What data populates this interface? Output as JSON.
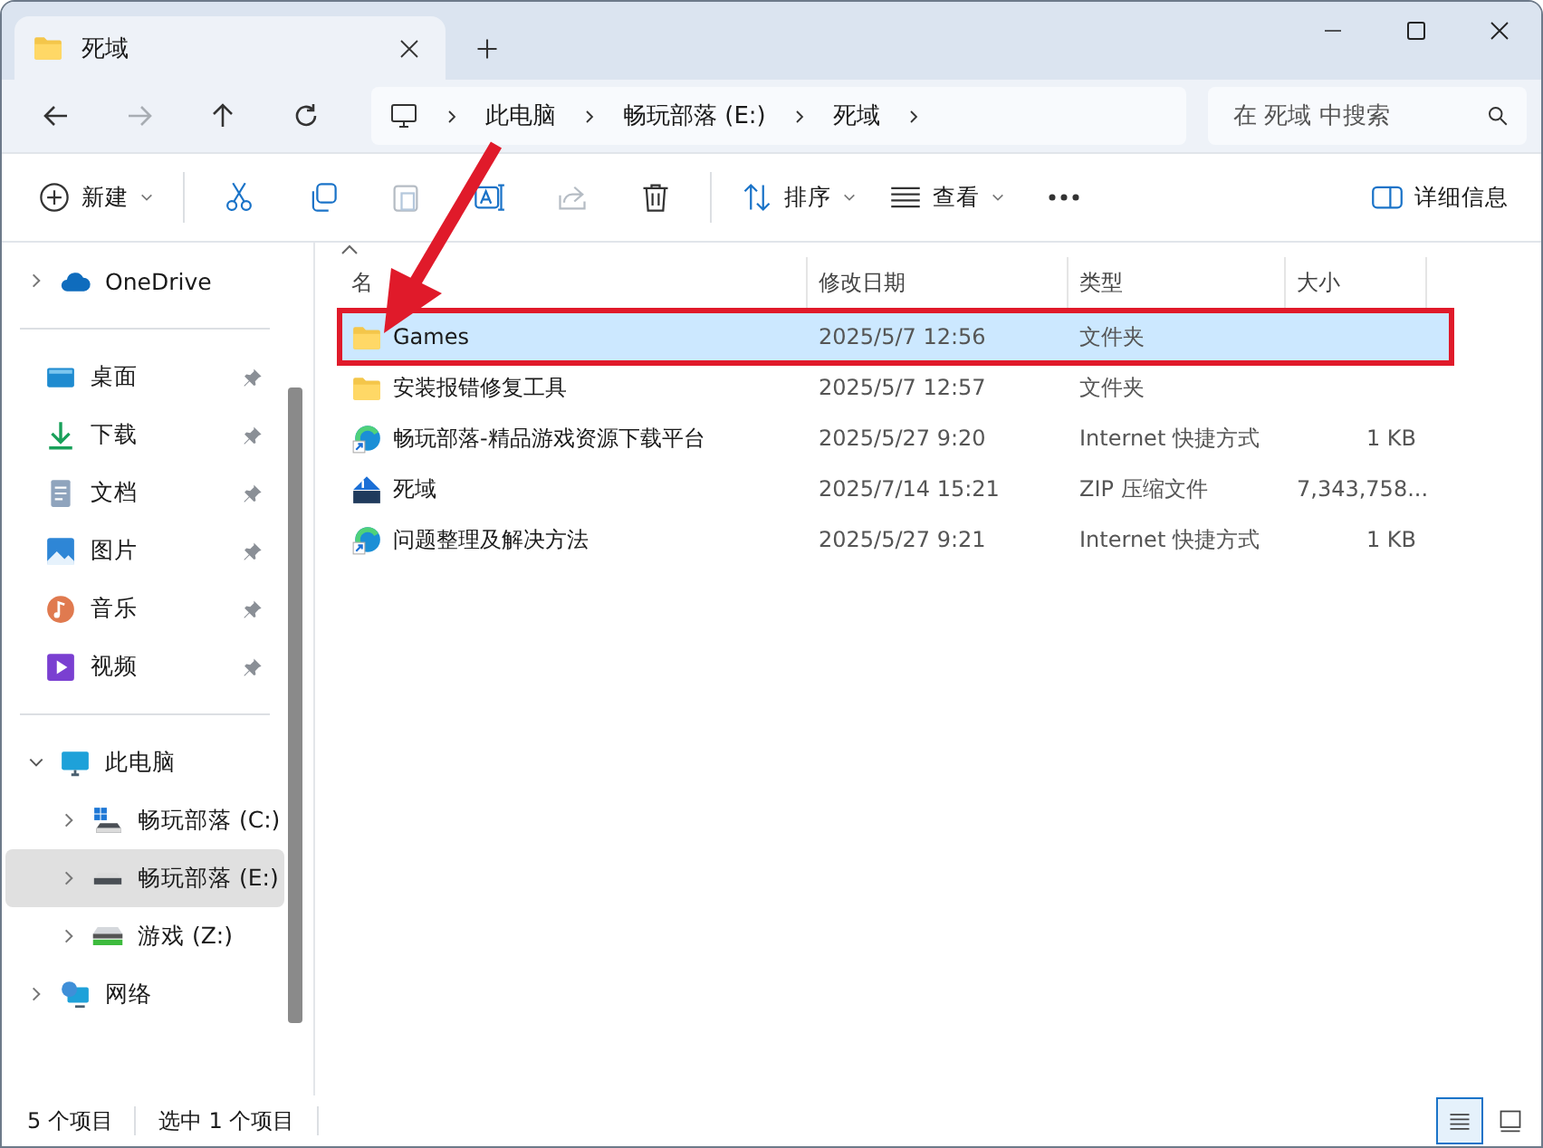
{
  "tab": {
    "title": "死域"
  },
  "nav": [
    {
      "kind": "back",
      "disabled": false
    },
    {
      "kind": "forward",
      "disabled": true
    },
    {
      "kind": "up",
      "disabled": false
    },
    {
      "kind": "refresh",
      "disabled": false
    }
  ],
  "breadcrumbs": [
    "此电脑",
    "畅玩部落 (E:)",
    "死域"
  ],
  "search": {
    "placeholder": "在 死域 中搜索"
  },
  "toolbar": [
    {
      "kind": "new",
      "label": "新建",
      "disabled": false
    },
    {
      "kind": "cut",
      "disabled": false
    },
    {
      "kind": "copy",
      "disabled": false
    },
    {
      "kind": "paste",
      "disabled": true
    },
    {
      "kind": "rename",
      "disabled": false
    },
    {
      "kind": "share",
      "disabled": true
    },
    {
      "kind": "delete",
      "disabled": false
    },
    {
      "kind": "sort",
      "label": "排序",
      "disabled": false
    },
    {
      "kind": "view",
      "label": "查看",
      "disabled": false
    },
    {
      "kind": "more",
      "disabled": false
    }
  ],
  "details_button": {
    "label": "详细信息"
  },
  "sidebar": {
    "cloud": [
      {
        "kind": "onedrive",
        "label": "OneDrive",
        "expanded": false,
        "selected": false
      }
    ],
    "quick_access": [
      {
        "kind": "desktop",
        "label": "桌面",
        "pinned": true
      },
      {
        "kind": "download",
        "label": "下载",
        "pinned": true
      },
      {
        "kind": "documents",
        "label": "文档",
        "pinned": true
      },
      {
        "kind": "pictures",
        "label": "图片",
        "pinned": true
      },
      {
        "kind": "music",
        "label": "音乐",
        "pinned": true
      },
      {
        "kind": "videos",
        "label": "视频",
        "pinned": true
      }
    ],
    "tree": [
      {
        "kind": "pc",
        "label": "此电脑",
        "expanded": true,
        "selected": false,
        "children": [
          {
            "kind": "system-drive",
            "label": "畅玩部落 (C:)",
            "expanded": false,
            "selected": false
          },
          {
            "kind": "drive",
            "label": "畅玩部落 (E:)",
            "expanded": false,
            "selected": true
          },
          {
            "kind": "net-drive",
            "label": "游戏 (Z:)",
            "expanded": false,
            "selected": false
          }
        ]
      },
      {
        "kind": "network",
        "label": "网络",
        "expanded": false,
        "selected": false
      }
    ]
  },
  "table": {
    "columns": [
      "名",
      "修改日期",
      "类型",
      "大小"
    ],
    "rows": [
      {
        "kind": "folder",
        "name": "Games",
        "date": "2025/5/7 12:56",
        "type": "文件夹",
        "selected": true
      },
      {
        "kind": "folder",
        "name": "安装报错修复工具",
        "date": "2025/5/7 12:57",
        "type": "文件夹",
        "selected": false
      },
      {
        "kind": "web-shortcut",
        "name": "畅玩部落-精品游戏资源下载平台",
        "date": "2025/5/27 9:20",
        "type": "Internet 快捷方式",
        "size": "1 KB",
        "selected": false
      },
      {
        "kind": "zip",
        "name": "死域",
        "date": "2025/7/14 15:21",
        "type": "ZIP 压缩文件",
        "size": "7,343,758...",
        "selected": false
      },
      {
        "kind": "web-shortcut",
        "name": "问题整理及解决方法",
        "date": "2025/5/27 9:21",
        "type": "Internet 快捷方式",
        "size": "1 KB",
        "selected": false
      }
    ]
  },
  "status_bar": {
    "count": "5 个项目",
    "selection": "选中 1 个项目"
  },
  "view_modes": [
    {
      "kind": "details",
      "selected": true
    },
    {
      "kind": "tiles",
      "selected": false
    }
  ]
}
